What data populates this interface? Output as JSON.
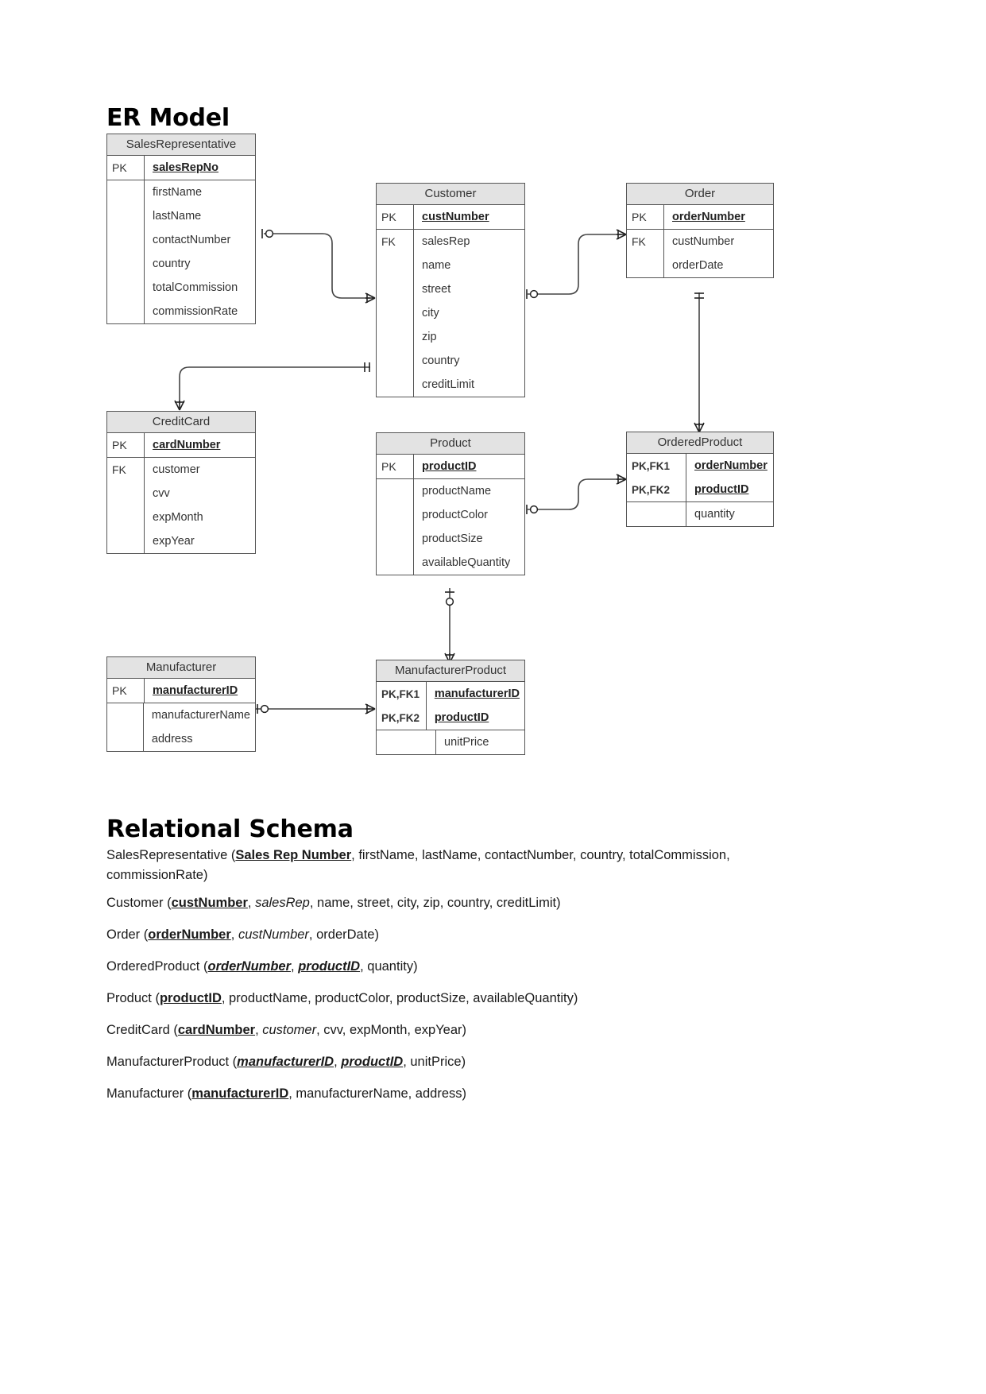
{
  "document": {
    "er_heading": "ER Model",
    "schema_heading": "Relational Schema"
  },
  "entities": [
    {
      "id": "SalesRepresentative",
      "name": "SalesRepresentative",
      "keys": [
        {
          "key": "PK",
          "attr": "salesRepNo"
        }
      ],
      "attributes": [
        "firstName",
        "lastName",
        "contactNumber",
        "country",
        "totalCommission",
        "commissionRate"
      ]
    },
    {
      "id": "Customer",
      "name": "Customer",
      "keys": [
        {
          "key": "PK",
          "attr": "custNumber"
        }
      ],
      "fk_label": "FK",
      "attributes": [
        "salesRep",
        "name",
        "street",
        "city",
        "zip",
        "country",
        "creditLimit"
      ]
    },
    {
      "id": "Order",
      "name": "Order",
      "keys": [
        {
          "key": "PK",
          "attr": "orderNumber"
        }
      ],
      "fk_label": "FK",
      "attributes": [
        "custNumber",
        "orderDate"
      ]
    },
    {
      "id": "CreditCard",
      "name": "CreditCard",
      "keys": [
        {
          "key": "PK",
          "attr": "cardNumber"
        }
      ],
      "fk_label": "FK",
      "attributes": [
        "customer",
        "cvv",
        "expMonth",
        "expYear"
      ]
    },
    {
      "id": "Product",
      "name": "Product",
      "keys": [
        {
          "key": "PK",
          "attr": "productID"
        }
      ],
      "attributes": [
        "productName",
        "productColor",
        "productSize",
        "availableQuantity"
      ]
    },
    {
      "id": "OrderedProduct",
      "name": "OrderedProduct",
      "keys": [
        {
          "key": "PK,FK1",
          "attr": "orderNumber"
        },
        {
          "key": "PK,FK2",
          "attr": "productID"
        }
      ],
      "attributes": [
        "quantity"
      ]
    },
    {
      "id": "Manufacturer",
      "name": "Manufacturer",
      "keys": [
        {
          "key": "PK",
          "attr": "manufacturerID"
        }
      ],
      "attributes": [
        "manufacturerName",
        "address"
      ]
    },
    {
      "id": "ManufacturerProduct",
      "name": "ManufacturerProduct",
      "keys": [
        {
          "key": "PK,FK1",
          "attr": "manufacturerID"
        },
        {
          "key": "PK,FK2",
          "attr": "productID"
        }
      ],
      "attributes": [
        "unitPrice"
      ]
    }
  ],
  "relations": [
    {
      "from": "SalesRepresentative",
      "to": "Customer",
      "from_card": "one-optional",
      "to_card": "many-mandatory"
    },
    {
      "from": "Customer",
      "to": "Order",
      "from_card": "one-optional",
      "to_card": "many-mandatory"
    },
    {
      "from": "Customer",
      "to": "CreditCard",
      "from_card": "one-mandatory",
      "to_card": "many-mandatory"
    },
    {
      "from": "Order",
      "to": "OrderedProduct",
      "from_card": "one-mandatory",
      "to_card": "many-mandatory"
    },
    {
      "from": "Product",
      "to": "OrderedProduct",
      "from_card": "one-optional",
      "to_card": "many-mandatory"
    },
    {
      "from": "Product",
      "to": "ManufacturerProduct",
      "from_card": "one-optional",
      "to_card": "many-mandatory"
    },
    {
      "from": "Manufacturer",
      "to": "ManufacturerProduct",
      "from_card": "one-optional",
      "to_card": "many-mandatory"
    }
  ],
  "schema_lines": [
    {
      "id": "salesrepresentative",
      "relation": "SalesRepresentative",
      "primary_keys": [
        "Sales Rep Number"
      ],
      "foreign_keys": [],
      "attributes": [
        "firstName",
        "lastName",
        "contactNumber",
        "country",
        "totalCommission",
        "commissionRate"
      ],
      "html": "SalesRepresentative (<b>Sales Rep Number</b>, firstName, lastName, contactNumber, country, totalCommission, commissionRate)"
    },
    {
      "id": "customer",
      "relation": "Customer",
      "primary_keys": [
        "custNumber"
      ],
      "foreign_keys": [
        "salesRep"
      ],
      "attributes": [
        "name",
        "street",
        "city",
        "zip",
        "country",
        "creditLimit"
      ],
      "html": "Customer (<b>custNumber</b>, <i>salesRep</i>, name, street, city, zip, country, creditLimit)"
    },
    {
      "id": "order",
      "relation": "Order",
      "primary_keys": [
        "orderNumber"
      ],
      "foreign_keys": [
        "custNumber"
      ],
      "attributes": [
        "orderDate"
      ],
      "html": "Order (<b>orderNumber</b>, <i>custNumber</i>, orderDate)"
    },
    {
      "id": "orderedproduct",
      "relation": "OrderedProduct",
      "primary_keys": [
        "orderNumber",
        "productID"
      ],
      "foreign_keys": [
        "orderNumber",
        "productID"
      ],
      "attributes": [
        "quantity"
      ],
      "html": "OrderedProduct (<b class=\"bi\">orderNumber</b>, <b class=\"bi\">productID</b>, quantity)"
    },
    {
      "id": "product",
      "relation": "Product",
      "primary_keys": [
        "productID"
      ],
      "foreign_keys": [],
      "attributes": [
        "productName",
        "productColor",
        "productSize",
        "availableQuantity"
      ],
      "html": "Product (<b>productID</b>, productName, productColor, productSize, availableQuantity)"
    },
    {
      "id": "creditcard",
      "relation": "CreditCard",
      "primary_keys": [
        "cardNumber"
      ],
      "foreign_keys": [
        "customer"
      ],
      "attributes": [
        "cvv",
        "expMonth",
        "expYear"
      ],
      "html": "CreditCard (<b>cardNumber</b>, <i>customer</i>, cvv, expMonth, expYear)"
    },
    {
      "id": "manufacturerproduct",
      "relation": "ManufacturerProduct",
      "primary_keys": [
        "manufacturerID",
        "productID"
      ],
      "foreign_keys": [
        "manufacturerID",
        "productID"
      ],
      "attributes": [
        "unitPrice"
      ],
      "html": "ManufacturerProduct (<b class=\"bi\">manufacturerID</b>, <b class=\"bi\">productID</b>, unitPrice)"
    },
    {
      "id": "manufacturer",
      "relation": "Manufacturer",
      "primary_keys": [
        "manufacturerID"
      ],
      "foreign_keys": [],
      "attributes": [
        "manufacturerName",
        "address"
      ],
      "html": "Manufacturer (<b>manufacturerID</b>, manufacturerName, address)"
    }
  ],
  "colors": {
    "header_fill": "#e3e3e3",
    "border": "#555555",
    "text": "#333333",
    "page_background": "#ffffff"
  }
}
